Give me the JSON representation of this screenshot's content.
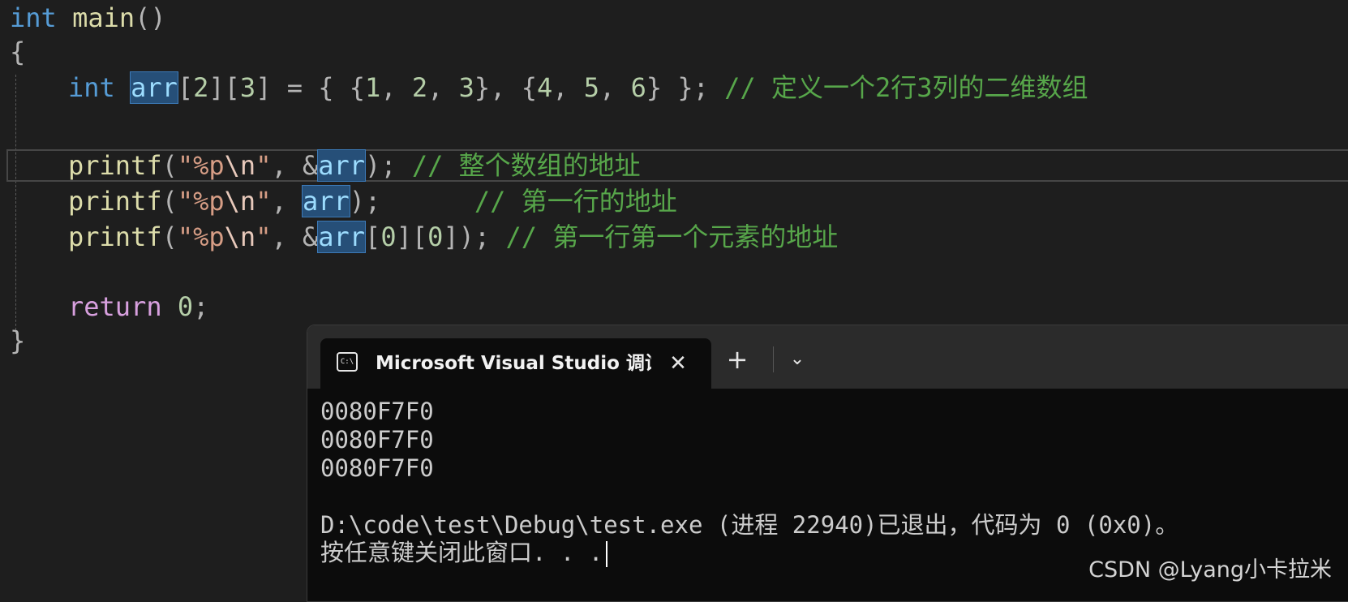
{
  "editor": {
    "lines": [
      [
        "int",
        "main",
        "()"
      ],
      [
        "{"
      ],
      [
        "int",
        "arr",
        "[",
        "2",
        "][",
        "3",
        "]",
        " = { {",
        "1",
        ", ",
        "2",
        ", ",
        "3",
        "}, {",
        "4",
        ", ",
        "5",
        ", ",
        "6",
        "} };",
        " // 定义一个2行3列的二维数组"
      ],
      [],
      [
        "printf",
        "(",
        "\"%p",
        "\\n",
        "\"",
        ", &",
        "arr",
        ");",
        " // 整个数组的地址"
      ],
      [
        "printf",
        "(",
        "\"%p",
        "\\n",
        "\"",
        ", ",
        "arr",
        ");",
        "      // 第一行的地址"
      ],
      [
        "printf",
        "(",
        "\"%p",
        "\\n",
        "\"",
        ", &",
        "arr",
        "[",
        "0",
        "][",
        "0",
        "]);",
        " // 第一行第一个元素的地址"
      ],
      [],
      [
        "return",
        " ",
        "0",
        ";"
      ],
      [
        "}"
      ]
    ]
  },
  "console": {
    "tab_icon_text": "C:\\",
    "tab_title": "Microsoft Visual Studio 调试控制台",
    "close_glyph": "✕",
    "new_tab_glyph": "+",
    "dropdown_glyph": "⌄",
    "output_lines": [
      "0080F7F0",
      "0080F7F0",
      "0080F7F0",
      "",
      "D:\\code\\test\\Debug\\test.exe (进程 22940)已退出，代码为 0 (0x0)。",
      "按任意键关闭此窗口. . ."
    ]
  },
  "watermark": "CSDN @Lyang小卡拉米",
  "colors": {
    "background": "#1e1e1e",
    "keyword": "#569cd6",
    "control_keyword": "#d8a0df",
    "function": "#dcdcaa",
    "string": "#d69d85",
    "number": "#b5cea8",
    "comment": "#57a64a",
    "highlight": "#264f78",
    "console_bg": "#0c0c0c"
  }
}
